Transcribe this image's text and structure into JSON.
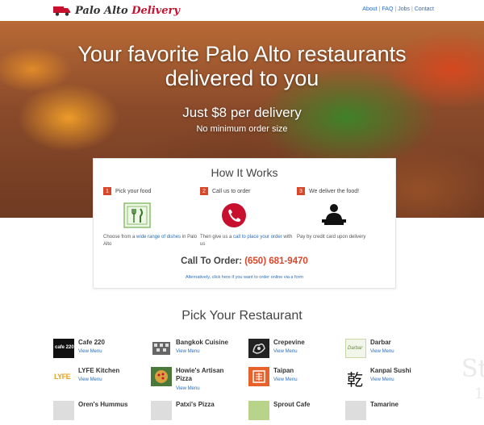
{
  "brand": {
    "name_part1": "Palo Alto",
    "name_part2": "Delivery"
  },
  "nav": {
    "about": "About",
    "faq": "FAQ",
    "jobs": "Jobs",
    "contact": "Contact",
    "separator": "|"
  },
  "hero": {
    "title_line1": "Your favorite Palo Alto restaurants",
    "title_line2": "delivered to you",
    "price": "Just $8 per delivery",
    "min_order": "No minimum order size"
  },
  "how_it_works": {
    "title": "How It Works",
    "steps": [
      {
        "num": "1",
        "label": "Pick your food",
        "icon": "fork-knife-icon",
        "desc_pre": "Choose from a ",
        "desc_link": "wide range of dishes",
        "desc_post": " in Palo Alto"
      },
      {
        "num": "2",
        "label": "Call us to order",
        "icon": "phone-icon",
        "desc_pre": "Then give us a ",
        "desc_link": "call to place your order",
        "desc_post": " with us"
      },
      {
        "num": "3",
        "label": "We deliver the food!",
        "icon": "delivery-person-icon",
        "desc_pre": "Pay by credit card upon delivery",
        "desc_link": "",
        "desc_post": ""
      }
    ],
    "call_label": "Call To Order:",
    "phone": "(650) 681-9470",
    "alt_link": "Alternatively, click here if you want to order online via a form"
  },
  "pick": {
    "title": "Pick Your Restaurant",
    "view_menu": "View Menu",
    "restaurants": [
      {
        "name": "Cafe 220",
        "logo_text": "cafe 220",
        "color": "#111111"
      },
      {
        "name": "Bangkok Cuisine",
        "logo_text": "",
        "color": "#555555"
      },
      {
        "name": "Crepevine",
        "logo_text": "",
        "color": "#222222"
      },
      {
        "name": "Darbar",
        "logo_text": "Darbar",
        "color": "#6a8a3a"
      },
      {
        "name": "LYFE Kitchen",
        "logo_text": "LYFE",
        "color": "#e8a020"
      },
      {
        "name": "Howie's Artisan Pizza",
        "logo_text": "",
        "color": "#4a7a3a"
      },
      {
        "name": "Taipan",
        "logo_text": "",
        "color": "#e8602a"
      },
      {
        "name": "Kanpai Sushi",
        "logo_text": "乾",
        "color": "#111111"
      },
      {
        "name": "Oren's Hummus",
        "logo_text": "",
        "color": "#cccccc"
      },
      {
        "name": "Patxi's Pizza",
        "logo_text": "",
        "color": "#cccccc"
      },
      {
        "name": "Sprout Cafe",
        "logo_text": "",
        "color": "#8ab040"
      },
      {
        "name": "Tamarine",
        "logo_text": "",
        "color": "#cccccc"
      }
    ]
  },
  "watermark": {
    "line1": "St",
    "line2": "1"
  },
  "colors": {
    "accent_red": "#d9472b",
    "link_blue": "#2a6ebb",
    "brand_red": "#c8102e"
  }
}
